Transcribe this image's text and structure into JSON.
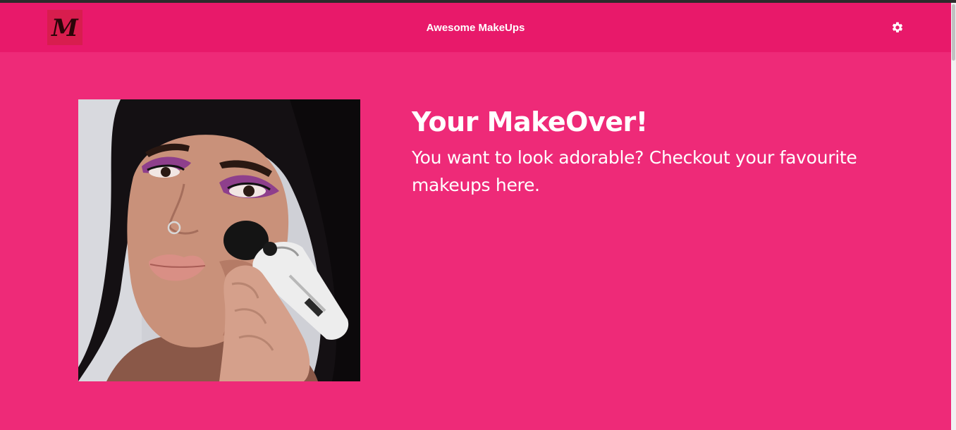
{
  "navbar": {
    "logo_letter": "M",
    "title": "Awesome MakeUps",
    "settings_icon": "gear-icon"
  },
  "hero": {
    "heading": "Your MakeOver!",
    "subtitle": "You want to look adorable? Checkout your favourite makeups here."
  },
  "colors": {
    "navbar": "#e8196a",
    "background": "#ee2a78",
    "logo_bg": "#d81d4e",
    "text": "#ffffff"
  }
}
